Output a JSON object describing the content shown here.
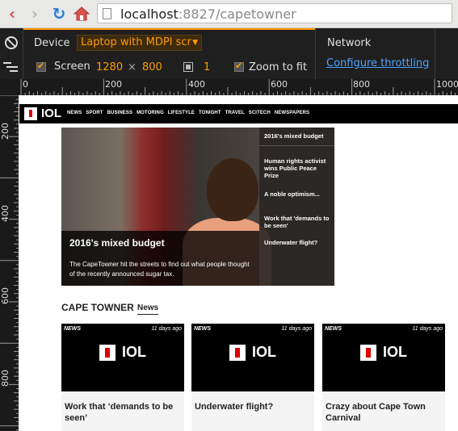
{
  "browser": {
    "url_host": "localhost",
    "url_rest": ":8827/capetowner"
  },
  "devtools": {
    "device_label": "Device",
    "device_value": "Laptop with MDPI scr",
    "screen_label": "Screen",
    "screen_width": "1280",
    "screen_times": "×",
    "screen_height": "800",
    "dpr_value": "1",
    "zoom_label": "Zoom to fit",
    "network_label": "Network",
    "throttling_link": "Configure throttling",
    "ruler_top": [
      "0",
      "200",
      "400",
      "600",
      "800",
      "1000"
    ],
    "ruler_left": [
      "200",
      "400",
      "600",
      "800"
    ]
  },
  "site": {
    "logo": "IOL",
    "nav": [
      "NEWS",
      "SPORT",
      "BUSINESS",
      "MOTORING",
      "LIFESTYLE",
      "TONIGHT",
      "TRAVEL",
      "SCITECH",
      "NEWSPAPERS"
    ],
    "hero": {
      "title": "2016's mixed budget",
      "description": "The CapeTowner hit the streets to find out what people thought of the recently announced sugar tax.",
      "side_items": [
        "2016's mixed budget",
        "Human rights activist wins Public Peace Prize",
        "A noble optimism...",
        "Work that 'demands to be seen'",
        "Underwater flight?"
      ]
    },
    "section_title": "CAPE TOWNER",
    "section_tab": "News",
    "cards": [
      {
        "tag": "NEWS",
        "time": "11 days ago",
        "logo": "IOL",
        "title": "Work that ‘demands to be seen’"
      },
      {
        "tag": "NEWS",
        "time": "11 days ago",
        "logo": "IOL",
        "title": "Underwater flight?"
      },
      {
        "tag": "NEWS",
        "time": "11 days ago",
        "logo": "IOL",
        "title": "Crazy about Cape Town Carnival"
      }
    ]
  }
}
